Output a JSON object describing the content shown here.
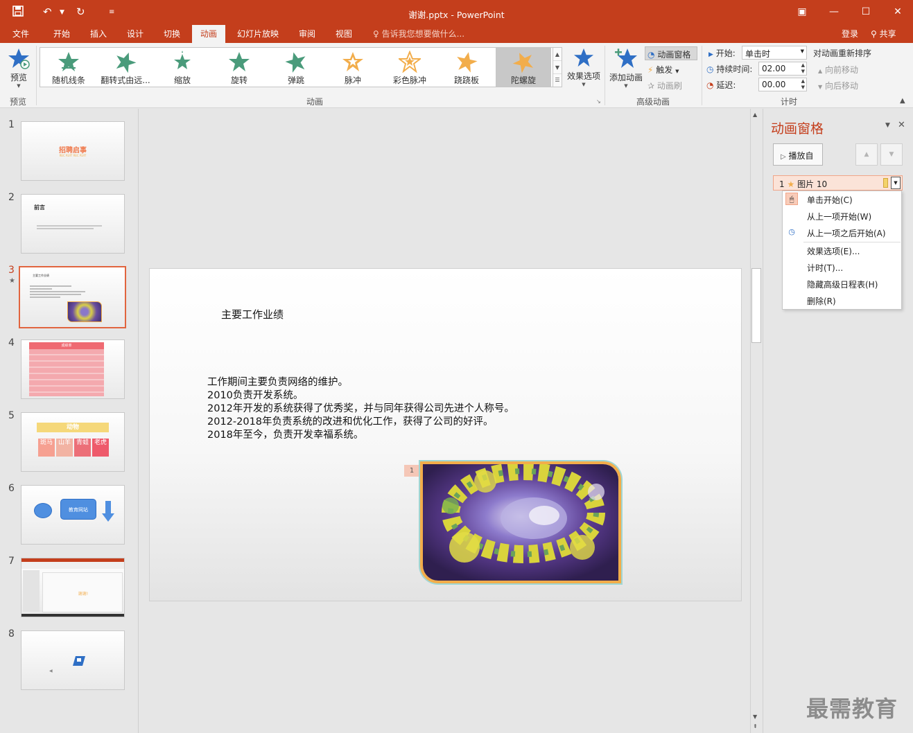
{
  "window": {
    "title": "谢谢.pptx - PowerPoint"
  },
  "menu": {
    "tabs": [
      "文件",
      "开始",
      "插入",
      "设计",
      "切换",
      "动画",
      "幻灯片放映",
      "审阅",
      "视图"
    ],
    "active_tab": "动画",
    "tell_me": "告诉我您想要做什么...",
    "login": "登录",
    "share": "共享"
  },
  "ribbon": {
    "preview": {
      "button": "预览",
      "group": "预览"
    },
    "animation_group_label": "动画",
    "gallery": [
      {
        "label": "随机线条",
        "color": "#4a9b7b"
      },
      {
        "label": "翻转式由远...",
        "color": "#4a9b7b"
      },
      {
        "label": "缩放",
        "color": "#4a9b7b"
      },
      {
        "label": "旋转",
        "color": "#4a9b7b"
      },
      {
        "label": "弹跳",
        "color": "#4a9b7b"
      },
      {
        "label": "脉冲",
        "color": "#f2ad4b"
      },
      {
        "label": "彩色脉冲",
        "color": "#f2ad4b"
      },
      {
        "label": "跷跷板",
        "color": "#f2ad4b"
      },
      {
        "label": "陀螺旋",
        "color": "#f2ad4b"
      }
    ],
    "selected_effect": "陀螺旋",
    "effect_options": "效果选项",
    "advanced": {
      "add_animation": "添加动画",
      "animation_pane": "动画窗格",
      "trigger": "触发",
      "painter": "动画刷",
      "group": "高级动画"
    },
    "timing": {
      "start_label": "开始:",
      "start_value": "单击时",
      "duration_label": "持续时间:",
      "duration_value": "02.00",
      "delay_label": "延迟:",
      "delay_value": "00.00",
      "reorder_title": "对动画重新排序",
      "move_earlier": "向前移动",
      "move_later": "向后移动",
      "group": "计时"
    }
  },
  "thumbnails": [
    {
      "num": "1",
      "title": "招聘启事",
      "sub": "REC RUIT  REC RUIT"
    },
    {
      "num": "2",
      "title": "前言"
    },
    {
      "num": "3",
      "title": "主要工作业绩"
    },
    {
      "num": "4",
      "title": "成绩单"
    },
    {
      "num": "5",
      "title": "动物",
      "cells": [
        "斑马",
        "山羊",
        "青蛙",
        "老虎"
      ]
    },
    {
      "num": "6",
      "label": "教育网站"
    },
    {
      "num": "7",
      "label": "谢谢!"
    },
    {
      "num": "8"
    }
  ],
  "current_slide": "3",
  "slide": {
    "title": "主要工作业绩",
    "body": [
      "工作期间主要负责网络的维护。",
      "2010负责开发系统。",
      "2012年开发的系统获得了优秀奖，并与同年获得公司先进个人称号。",
      "2012-2018年负责系统的改进和优化工作，获得了公司的好评。",
      "2018年至今，负责开发幸福系统。"
    ],
    "anim_tag": "1"
  },
  "anim_pane": {
    "title": "动画窗格",
    "play_button": "播放自",
    "item": {
      "index": "1",
      "name": "图片 10"
    },
    "menu": [
      {
        "label": "单击开始(C)",
        "icon": "mouse-click-icon"
      },
      {
        "label": "从上一项开始(W)",
        "icon": ""
      },
      {
        "label": "从上一项之后开始(A)",
        "icon": "clock-icon"
      },
      {
        "label": "效果选项(E)...",
        "icon": ""
      },
      {
        "label": "计时(T)...",
        "icon": ""
      },
      {
        "label": "隐藏高级日程表(H)",
        "icon": ""
      },
      {
        "label": "删除(R)",
        "icon": ""
      }
    ]
  },
  "watermark": "最需教育",
  "colors": {
    "accent": "#c43e1c",
    "ribbon_bg": "#f3f3f3",
    "workspace": "#e6e6e6",
    "selection": "#e1643e"
  }
}
